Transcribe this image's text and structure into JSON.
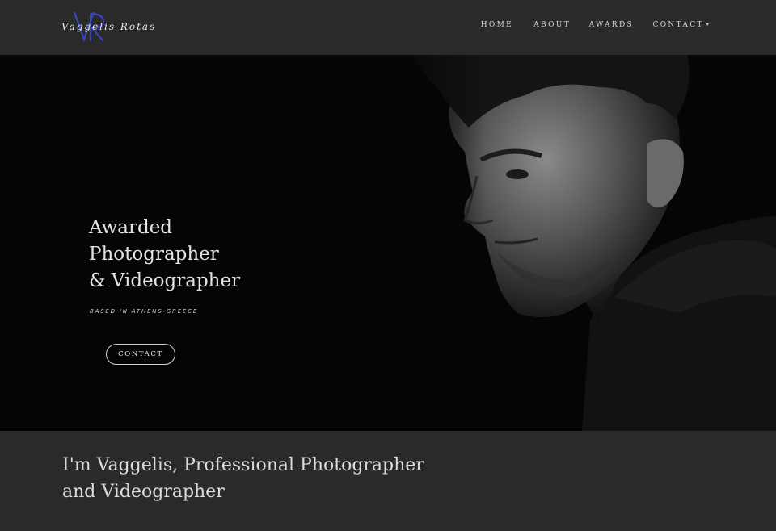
{
  "header": {
    "logo": {
      "monogram": "VR",
      "text": "Vaggelis Rotas"
    },
    "nav": [
      {
        "label": "HOME"
      },
      {
        "label": "ABOUT"
      },
      {
        "label": "AWARDS"
      },
      {
        "label": "CONTACT",
        "has_dropdown": true,
        "caret": "▾"
      }
    ]
  },
  "hero": {
    "title_lines": [
      "Awarded",
      "Photographer",
      "& Videographer"
    ],
    "subtitle": "BASED IN ATHENS-GREECE",
    "cta_label": "CONTACT",
    "photo_icon": "portrait-photo"
  },
  "intro": {
    "heading": "I'm Vaggelis, Professional Photographer and Videographer"
  },
  "colors": {
    "header_bg": "#2a2a2a",
    "hero_bg": "#050505",
    "accent_monogram": "#3b46b8",
    "text_light": "#e4e4e4"
  }
}
